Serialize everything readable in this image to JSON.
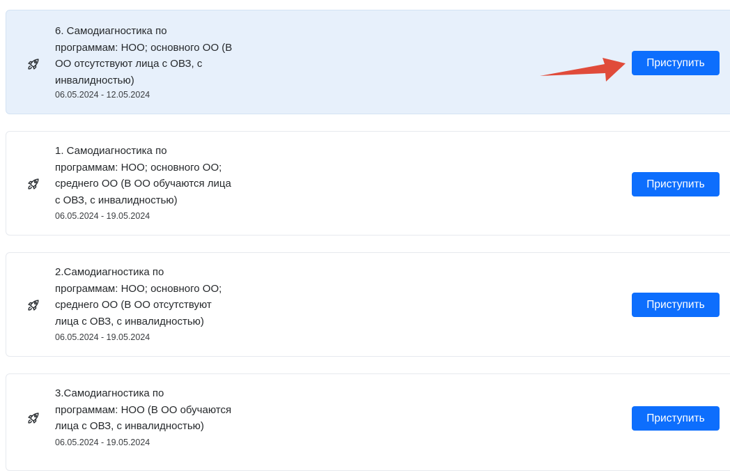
{
  "colors": {
    "accent": "#0d6efd",
    "highlight_background": "#e7f0fb",
    "annotation_arrow": "#e04b3a"
  },
  "icon": "rocket-icon",
  "tasks": [
    {
      "title": "6. Самодиагностика по\nпрограммам: НОО; основного ОО (В\nОО отсутствуют лица с ОВЗ, с\nинвалидностью)",
      "dates": "06.05.2024 - 12.05.2024",
      "button_label": "Приступить",
      "highlighted": true
    },
    {
      "title": "1. Самодиагностика по\nпрограммам: НОО; основного ОО;\nсреднего ОО (В ОО обучаются лица\nс ОВЗ, с инвалидностью)",
      "dates": "06.05.2024 - 19.05.2024",
      "button_label": "Приступить",
      "highlighted": false
    },
    {
      "title": "2.Самодиагностика по\nпрограммам: НОО; основного ОО;\nсреднего ОО (В ОО отсутствуют\nлица с ОВЗ, с инвалидностью)",
      "dates": "06.05.2024 - 19.05.2024",
      "button_label": "Приступить",
      "highlighted": false
    },
    {
      "title": "3.Самодиагностика по\nпрограммам: НОО (В ОО обучаются\nлица с ОВЗ, с инвалидностью)",
      "dates": "06.05.2024 - 19.05.2024",
      "button_label": "Приступить",
      "highlighted": false
    }
  ]
}
